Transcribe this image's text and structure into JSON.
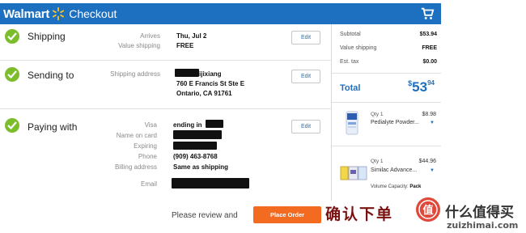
{
  "header": {
    "logo_text": "Walmart",
    "title": "Checkout",
    "cart_icon": "cart-icon",
    "brand_color": "#1d6fc0"
  },
  "shipping": {
    "title": "Shipping",
    "arrives_label": "Arrives",
    "arrives_value": "Thu, Jul 2",
    "value_shipping_label": "Value shipping",
    "value_shipping_value": "FREE",
    "edit_label": "Edit"
  },
  "sending": {
    "title": "Sending to",
    "address_label": "Shipping address",
    "name_partial": "ijixiang",
    "street": "760 E Francis St Ste E",
    "city": "Ontario, CA 91761",
    "edit_label": "Edit"
  },
  "paying": {
    "title": "Paying with",
    "card_type_label": "Visa",
    "card_value": "ending in",
    "name_label": "Name on card",
    "expiring_label": "Expiring",
    "phone_label": "Phone",
    "phone_value": "(909) 463-8768",
    "billing_label": "Billing address",
    "billing_value": "Same as shipping",
    "email_label": "Email",
    "edit_label": "Edit"
  },
  "summary": {
    "subtotal_label": "Subtotal",
    "subtotal_value": "$53.94",
    "value_shipping_label": "Value shipping",
    "value_shipping_value": "FREE",
    "tax_label": "Est. tax",
    "tax_value": "$0.00",
    "total_label": "Total",
    "total_currency": "$",
    "total_dollars": "53",
    "total_cents": "94",
    "items": [
      {
        "qty": "Qty 1",
        "price": "$8.98",
        "name": "Pedialyte Powder..."
      },
      {
        "qty": "Qty 1",
        "price": "$44.96",
        "name": "Similac Advance..."
      }
    ],
    "volume_label": "Volume Capacity:",
    "volume_value": "Pack"
  },
  "footer": {
    "review_text": "Please review and",
    "place_order_label": "Place Order",
    "button_color": "#f26b21"
  },
  "watermark": {
    "confirm_text": "确认下单",
    "logo_char": "值",
    "site_name": "什么值得买",
    "site_url": "zuizhimai.com"
  }
}
